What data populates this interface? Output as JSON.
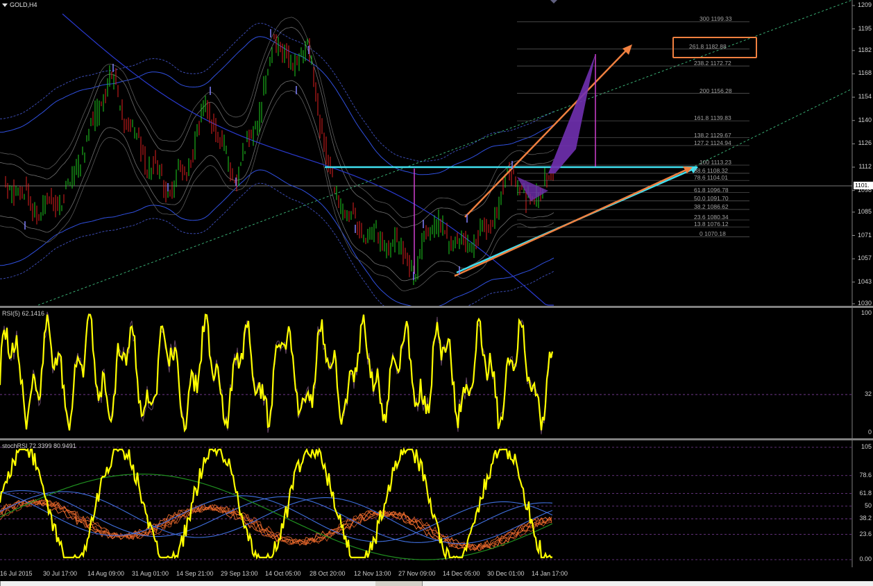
{
  "chart": {
    "title": "GOLD,H4",
    "current_price_tag": "1101.",
    "price_scale": [
      "1209",
      "1195",
      "1182",
      "1168",
      "1154",
      "1140",
      "1126",
      "1112",
      "1098",
      "1085",
      "1071",
      "1057",
      "1043",
      "1030"
    ],
    "fib_levels": [
      {
        "label": "300 1199.33",
        "value": 1199.33
      },
      {
        "label": "261.8 1182.88",
        "value": 1182.88
      },
      {
        "label": "238.2 1172.72",
        "value": 1172.72
      },
      {
        "label": "200 1156.28",
        "value": 1156.28
      },
      {
        "label": "161.8 1139.83",
        "value": 1139.83
      },
      {
        "label": "138.2 1129.67",
        "value": 1129.67
      },
      {
        "label": "127.2 1124.94",
        "value": 1124.94
      },
      {
        "label": "100 1113.23",
        "value": 1113.23
      },
      {
        "label": "88.6 1108.32",
        "value": 1108.32
      },
      {
        "label": "78.6 1104.01",
        "value": 1104.01
      },
      {
        "label": "61.8 1096.78",
        "value": 1096.78
      },
      {
        "label": "50.0 1091.70",
        "value": 1091.7
      },
      {
        "label": "38.2 1086.62",
        "value": 1086.62
      },
      {
        "label": "23.6 1080.34",
        "value": 1080.34
      },
      {
        "label": "13.8 1076.12",
        "value": 1076.12
      },
      {
        "label": "0 1070.18",
        "value": 1070.18
      }
    ]
  },
  "rsi": {
    "label": "RSI(5) 62.1416",
    "scale": [
      "100",
      "32",
      "0"
    ]
  },
  "stoch": {
    "label": "stochRSI 72.3399 80.9491",
    "scale": [
      "105",
      "78.6",
      "61.8",
      "50",
      "38.2",
      "23.6",
      "0.00"
    ]
  },
  "time_axis": [
    "16 Jul 2015",
    "30 Jul 17:00",
    "14 Aug 09:00",
    "31 Aug 01:00",
    "14 Sep 21:00",
    "29 Sep 13:00",
    "14 Oct 05:00",
    "28 Oct 20:00",
    "12 Nov 13:00",
    "27 Nov 09:00",
    "14 Dec 05:00",
    "30 Dec 01:00",
    "14 Jan 17:00"
  ],
  "colors": {
    "background": "#000000",
    "rsi_line": "#ffff00",
    "cyan_line": "#40e0f0",
    "orange_arrow": "#f08040",
    "magenta": "#d040d0",
    "projection_fill": "#7030b0",
    "channel_blue": "#3050e0",
    "trend_green": "#40c080"
  },
  "icons": [
    "dropdown-triangle-icon",
    "scroll-marker-icon"
  ]
}
